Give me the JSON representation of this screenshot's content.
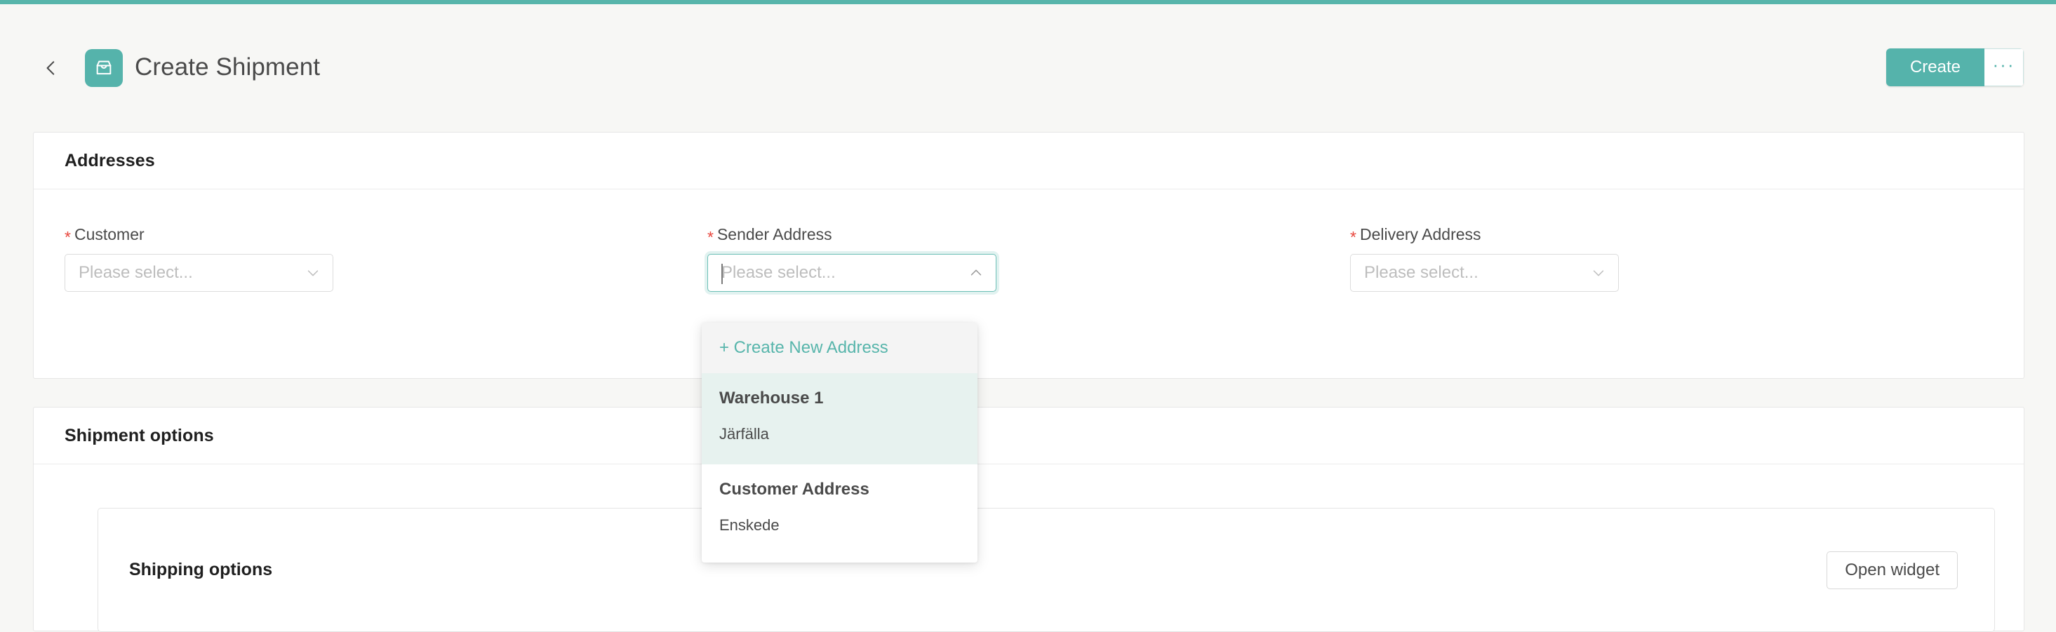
{
  "theme": {
    "accent": "#58b5ab",
    "accent_icon_bg": "#55b3ab",
    "page_bg": "#f7f7f5",
    "required_asterisk": "#e8453c",
    "dropdown_highlight_bg": "#e7f2ef",
    "dropdown_create_bg": "#f4f4f4"
  },
  "header": {
    "back_icon": "chevron-left-icon",
    "title_icon": "inbox-tray-icon",
    "title": "Create Shipment",
    "create_label": "Create",
    "more_label": "···"
  },
  "addresses_card": {
    "title": "Addresses",
    "required_marker": "*",
    "fields": [
      {
        "label": "Customer",
        "required": true,
        "placeholder": "Please select...",
        "value": "",
        "open": false,
        "chevron": "chevron-down-icon"
      },
      {
        "label": "Sender Address",
        "required": true,
        "placeholder": "Please select...",
        "value": "",
        "open": true,
        "chevron": "chevron-up-icon"
      },
      {
        "label": "Delivery Address",
        "required": true,
        "placeholder": "Please select...",
        "value": "",
        "open": false,
        "chevron": "chevron-down-icon"
      }
    ]
  },
  "dropdown": {
    "create_new_label": "+ Create New Address",
    "groups": [
      {
        "title": "Warehouse 1",
        "item": "Järfälla",
        "highlighted": true
      },
      {
        "title": "Customer Address",
        "item": "Enskede",
        "highlighted": false
      }
    ]
  },
  "shipment_card": {
    "title": "Shipment options",
    "inner": {
      "title": "Shipping options",
      "button_label": "Open widget"
    }
  }
}
